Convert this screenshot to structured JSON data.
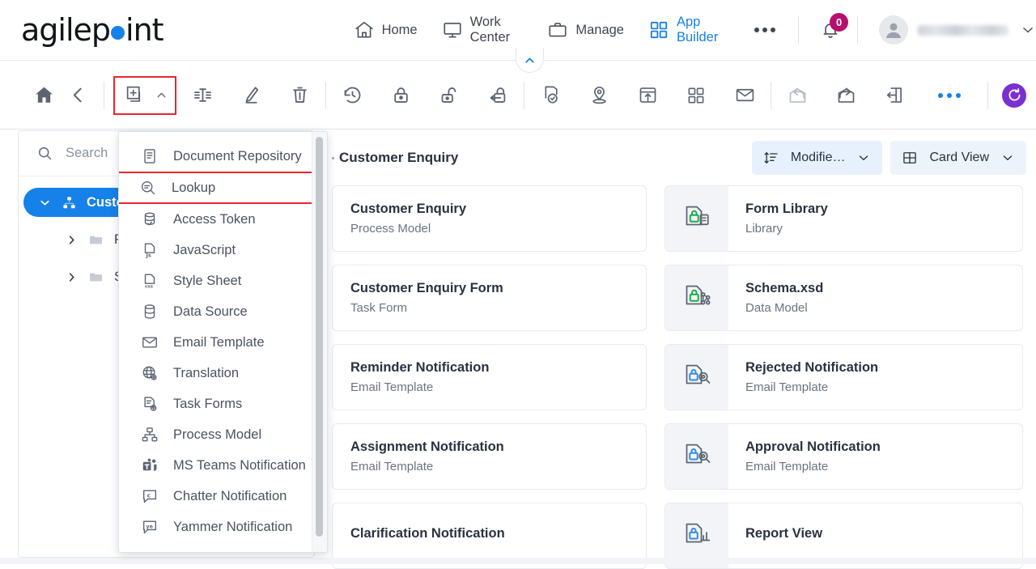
{
  "header": {
    "logo": {
      "before": "agilep",
      "dot": "o",
      "after": "int"
    },
    "nav": [
      {
        "label": "Home",
        "icon": "home-icon",
        "active": false
      },
      {
        "label": "Work Center",
        "icon": "monitor-icon",
        "active": false
      },
      {
        "label": "Manage",
        "icon": "briefcase-icon",
        "active": false
      },
      {
        "label": "App Builder",
        "icon": "grid-icon",
        "active": true
      }
    ],
    "more_label": "more-options",
    "notification_count": "0",
    "user_name_redacted": true
  },
  "toolbar": {
    "buttons": [
      {
        "name": "home-icon",
        "label": "Home"
      },
      {
        "name": "back-icon",
        "label": "Back"
      },
      {
        "name": "add-item-icon",
        "label": "Add"
      },
      {
        "name": "add-caret-icon",
        "label": "Add menu"
      },
      {
        "name": "rename-icon",
        "label": "Rename"
      },
      {
        "name": "edit-icon",
        "label": "Edit"
      },
      {
        "name": "delete-icon",
        "label": "Delete"
      },
      {
        "name": "history-icon",
        "label": "History"
      },
      {
        "name": "lock-icon",
        "label": "Check Out"
      },
      {
        "name": "unlock-icon",
        "label": "Check In"
      },
      {
        "name": "undo-checkout-icon",
        "label": "Undo Check Out"
      },
      {
        "name": "validate-icon",
        "label": "Validate"
      },
      {
        "name": "publish-icon",
        "label": "Publish"
      },
      {
        "name": "deploy-icon",
        "label": "Deploy"
      },
      {
        "name": "apps-icon",
        "label": "Apps"
      },
      {
        "name": "email-icon",
        "label": "Email"
      },
      {
        "name": "import-icon",
        "label": "Import"
      },
      {
        "name": "export-icon",
        "label": "Export"
      },
      {
        "name": "migrate-icon",
        "label": "Migrate"
      },
      {
        "name": "more-icon",
        "label": "More"
      },
      {
        "name": "refresh-icon",
        "label": "Refresh"
      }
    ],
    "highlight_color": "#e8262d",
    "refresh_color": "#7b2fd0"
  },
  "menu": {
    "selected": "Lookup",
    "highlight_color": "#e8262d",
    "items": [
      {
        "label": "Document Repository",
        "icon": "document-repository-icon"
      },
      {
        "label": "Lookup",
        "icon": "lookup-icon"
      },
      {
        "label": "Access Token",
        "icon": "access-token-icon"
      },
      {
        "label": "JavaScript",
        "icon": "javascript-icon"
      },
      {
        "label": "Style Sheet",
        "icon": "stylesheet-icon"
      },
      {
        "label": "Data Source",
        "icon": "data-source-icon"
      },
      {
        "label": "Email Template",
        "icon": "email-template-icon"
      },
      {
        "label": "Translation",
        "icon": "translation-icon"
      },
      {
        "label": "Task Forms",
        "icon": "task-forms-icon"
      },
      {
        "label": "Process Model",
        "icon": "process-model-icon"
      },
      {
        "label": "MS Teams Notification",
        "icon": "ms-teams-icon"
      },
      {
        "label": "Chatter Notification",
        "icon": "chatter-icon"
      },
      {
        "label": "Yammer Notification",
        "icon": "yammer-icon"
      }
    ]
  },
  "sidebar": {
    "search_placeholder": "Search",
    "tree": {
      "root": {
        "label": "Custom",
        "expanded": true
      },
      "children": [
        {
          "label": "Proce"
        },
        {
          "label": "Share"
        }
      ]
    }
  },
  "main": {
    "breadcrumb_title": "Customer Enquiry",
    "sort": {
      "label": "Modifie…",
      "icon": "sort-icon"
    },
    "view": {
      "label": "Card View",
      "icon": "card-view-icon"
    },
    "cards": [
      {
        "title": "Customer Enquiry",
        "subtitle": "Process Model",
        "icon": null,
        "column": "left"
      },
      {
        "title": "Form Library",
        "subtitle": "Library",
        "icon": "locked-form-library-icon",
        "lock_color": "#1faa4e",
        "column": "right"
      },
      {
        "title": "Customer Enquiry Form",
        "subtitle": "Task Form",
        "icon": null,
        "column": "left"
      },
      {
        "title": "Schema.xsd",
        "subtitle": "Data Model",
        "icon": "locked-data-model-icon",
        "lock_color": "#1faa4e",
        "column": "right"
      },
      {
        "title": "Reminder Notification",
        "subtitle": "Email Template",
        "icon": null,
        "column": "left"
      },
      {
        "title": "Rejected Notification",
        "subtitle": "Email Template",
        "icon": "locked-lookup-icon",
        "lock_color": "#2f8ce8",
        "column": "right"
      },
      {
        "title": "Assignment Notification",
        "subtitle": "Email Template",
        "icon": null,
        "column": "left"
      },
      {
        "title": "Approval Notification",
        "subtitle": "Email Template",
        "icon": "locked-lookup-icon",
        "lock_color": "#2f8ce8",
        "column": "right"
      },
      {
        "title": "Clarification Notification",
        "subtitle": "",
        "icon": null,
        "column": "left"
      },
      {
        "title": "Report View",
        "subtitle": "",
        "icon": "locked-report-icon",
        "lock_color": "#2f8ce8",
        "column": "right"
      }
    ]
  }
}
